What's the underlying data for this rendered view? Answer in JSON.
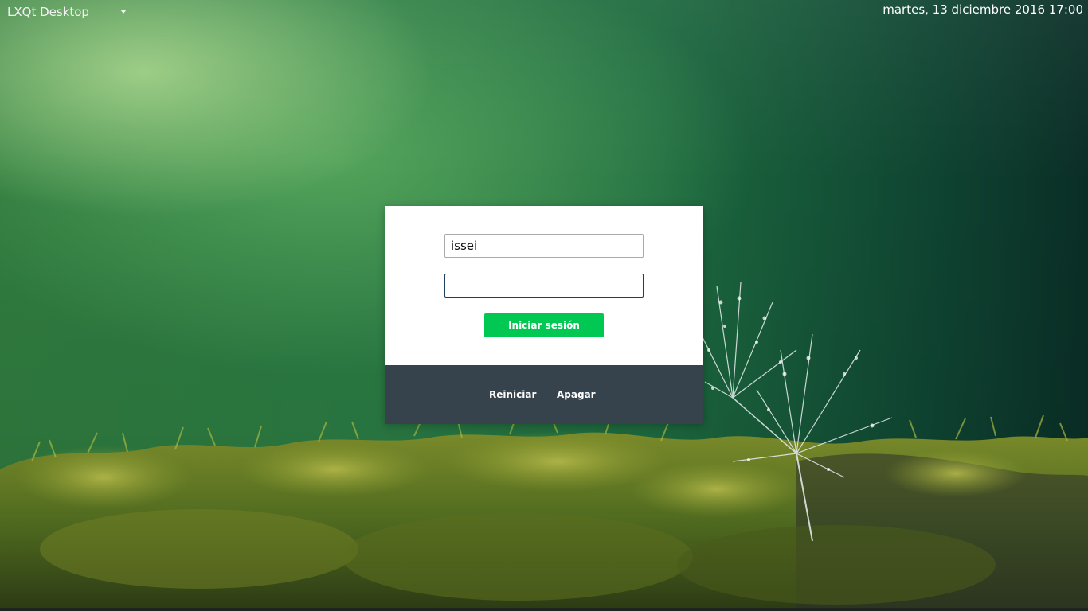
{
  "topbar": {
    "session_label": "LXQt Desktop",
    "session_icon": "chevron-down-icon",
    "clock_text": "martes, 13 diciembre 2016 17:00"
  },
  "login": {
    "username_value": "issei",
    "password_value": "",
    "login_button_label": "Iniciar sesión",
    "restart_label": "Reiniciar",
    "shutdown_label": "Apagar"
  },
  "colors": {
    "login_button": "#00c853",
    "footer_background": "#36434c",
    "card_background": "#ffffff"
  }
}
